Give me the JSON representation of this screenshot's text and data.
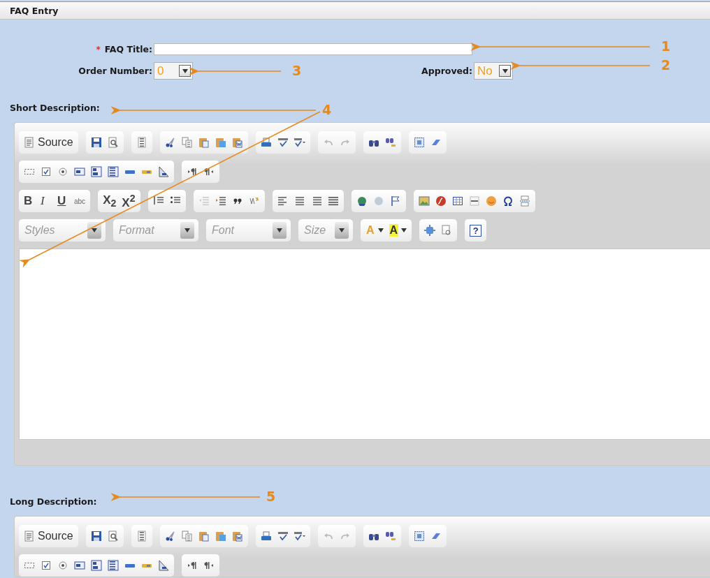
{
  "panel": {
    "title": "FAQ Entry"
  },
  "form": {
    "faq_title": {
      "label": "FAQ Title:",
      "required_mark": "*"
    },
    "order_number": {
      "label": "Order Number:",
      "value": "0"
    },
    "approved": {
      "label": "Approved:",
      "value": "No"
    }
  },
  "editors": [
    {
      "label": "Short Description:",
      "source_label": "Source",
      "format_labels": [
        "B",
        "I",
        "U",
        "abc",
        "X$_{2}$",
        "X$^{2}$"
      ],
      "combos": [
        {
          "placeholder": "Styles"
        },
        {
          "placeholder": "Format"
        },
        {
          "placeholder": "Font"
        },
        {
          "placeholder": "Size"
        }
      ],
      "color_labels": [
        "A",
        "A"
      ],
      "help_label": "?"
    },
    {
      "label": "Long Description:",
      "source_label": "Source"
    }
  ],
  "callouts": [
    {
      "number": "1"
    },
    {
      "number": "2"
    },
    {
      "number": "3"
    },
    {
      "number": "4"
    },
    {
      "number": "5"
    }
  ]
}
